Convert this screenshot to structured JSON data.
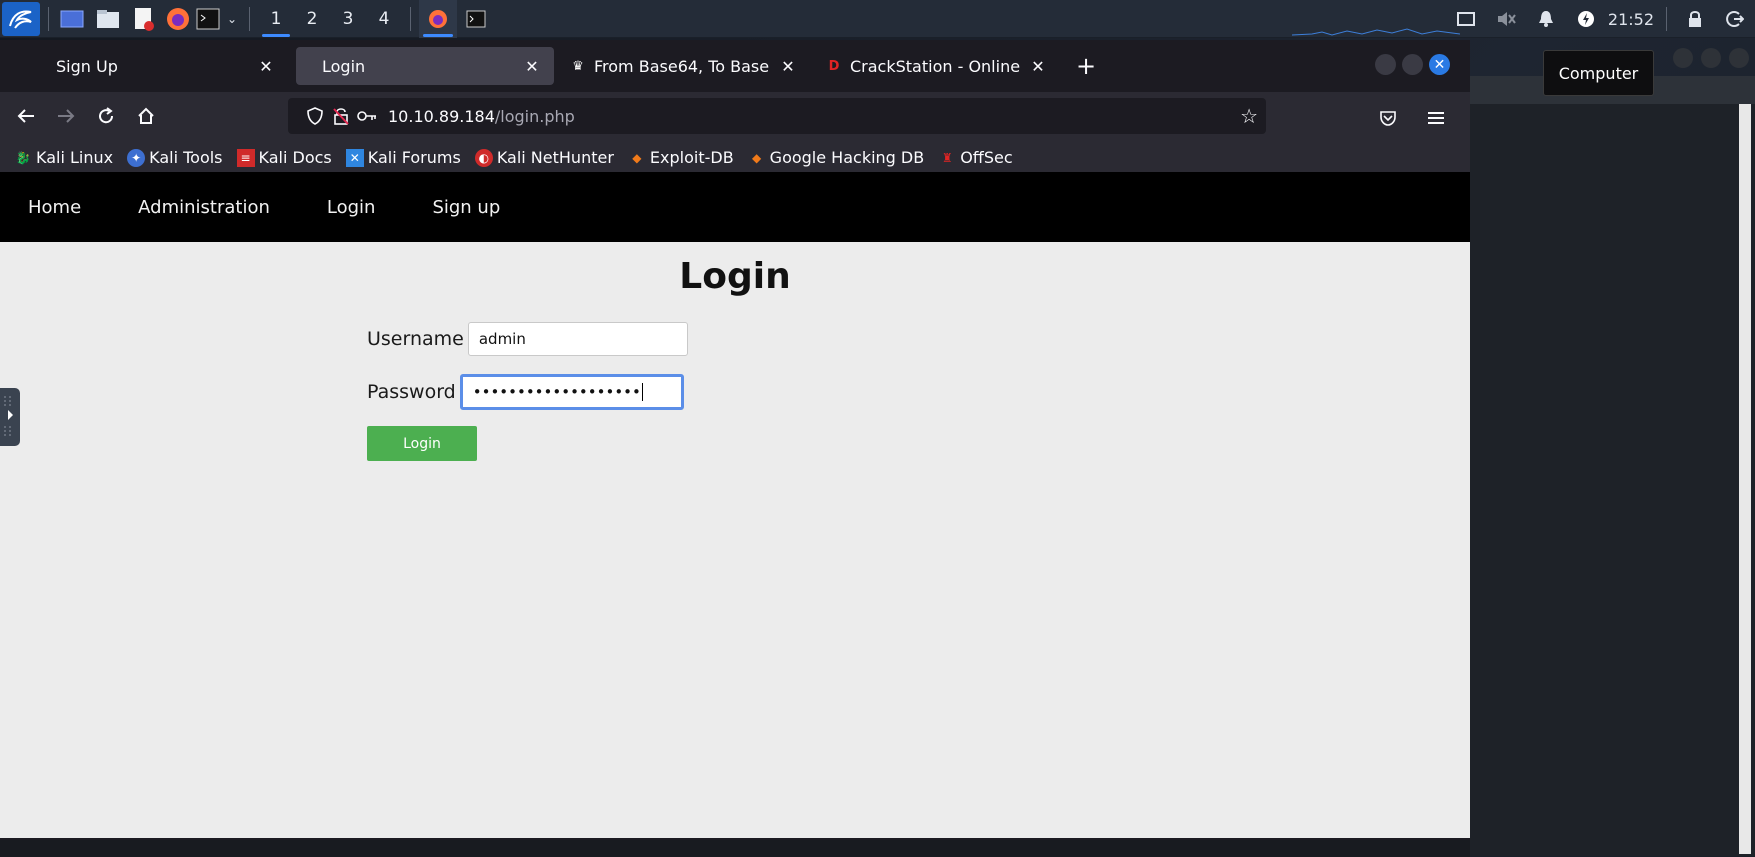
{
  "panel": {
    "workspaces": [
      "1",
      "2",
      "3",
      "4"
    ],
    "active_workspace": "1",
    "clock": "21:52",
    "tooltip": "Computer"
  },
  "browser": {
    "tabs": [
      {
        "title": "Sign Up",
        "active": false
      },
      {
        "title": "Login",
        "active": true
      },
      {
        "title": "From Base64, To Base64",
        "active": false
      },
      {
        "title": "CrackStation - Online Password",
        "active": false
      }
    ],
    "url_host": "10.10.89.184",
    "url_path": "/login.php",
    "bookmarks": [
      "Kali Linux",
      "Kali Tools",
      "Kali Docs",
      "Kali Forums",
      "Kali NetHunter",
      "Exploit-DB",
      "Google Hacking DB",
      "OffSec"
    ]
  },
  "page": {
    "nav": [
      "Home",
      "Administration",
      "Login",
      "Sign up"
    ],
    "title": "Login",
    "username_label": "Username",
    "username_value": "admin",
    "password_label": "Password",
    "password_value": "•••••••••••••••••••",
    "login_button": "Login"
  },
  "colors": {
    "accent": "#3d8bff",
    "login_button": "#4caf50",
    "focus_border": "#5b8ee8"
  }
}
